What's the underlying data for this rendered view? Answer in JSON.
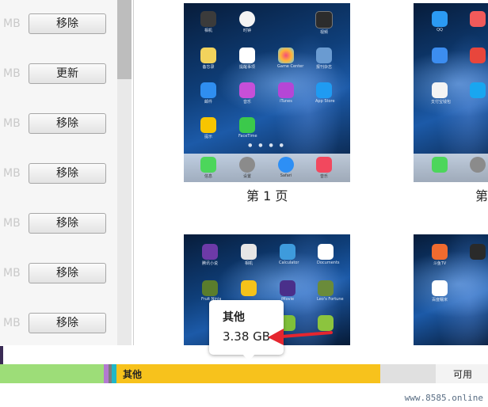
{
  "app_list": {
    "rows": [
      {
        "size_unit": "MB",
        "button": "移除"
      },
      {
        "size_unit": "MB",
        "button": "更新"
      },
      {
        "size_unit": "MB",
        "button": "移除"
      },
      {
        "size_unit": "MB",
        "button": "移除"
      },
      {
        "size_unit": "MB",
        "button": "移除"
      },
      {
        "size_unit": "MB",
        "button": "移除"
      },
      {
        "size_unit": "MB",
        "button": "移除"
      }
    ]
  },
  "pages": {
    "page1_label": "第 1 页",
    "page2_label_partial": "第",
    "page1_apps": [
      "相机",
      "时钟",
      "视频",
      "备忘录",
      "提醒事项",
      "Game Center",
      "报刊杂志",
      "邮件",
      "音乐",
      "iTunes",
      "App Store",
      "提示",
      "FaceTime"
    ],
    "page1_dock": [
      "信息",
      "设置",
      "Safari",
      "音乐"
    ],
    "page3_apps": [
      "腾讯小说",
      "相机",
      "Calculator",
      "Documents",
      "Fruit Ninja",
      "",
      "iMovie",
      "Leo's Fortune"
    ],
    "page2_apps": [
      "QQ",
      "",
      "",
      "",
      "",
      "",
      "",
      "支付宝钱包"
    ],
    "page4_apps": [
      "斗鱼TV",
      "",
      "百度糯米",
      ""
    ]
  },
  "tooltip": {
    "title": "其他",
    "value": "3.38 GB"
  },
  "storage_bar": {
    "other_label": "其他",
    "available_label": "可用"
  },
  "watermark": "www.8585.online",
  "colors": {
    "apps_segment": "#9ddd78",
    "purple_segment": "#b27ad0",
    "teal_segment": "#20b7c7",
    "other_segment": "#f7c21c",
    "available_segment": "#f3f3f3",
    "arrow": "#e5262f"
  }
}
